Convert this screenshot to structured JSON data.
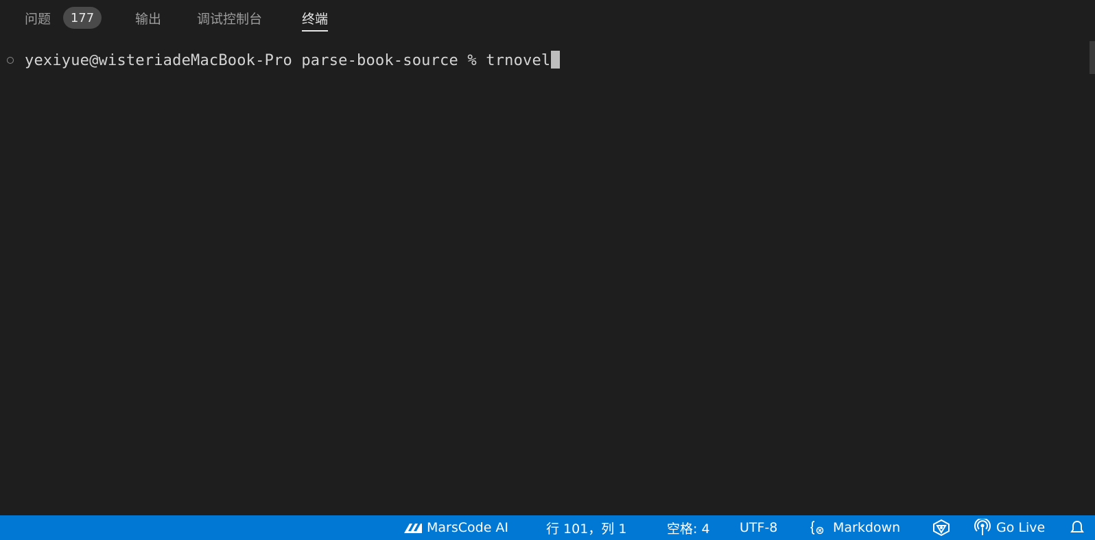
{
  "tabs": [
    {
      "label": "问题",
      "badge": "177"
    },
    {
      "label": "输出"
    },
    {
      "label": "调试控制台"
    },
    {
      "label": "终端"
    }
  ],
  "terminal": {
    "prompt": "yexiyue@wisteriadeMacBook-Pro parse-book-source % ",
    "command": "trnovel"
  },
  "statusbar": {
    "marscode": "MarsCode AI",
    "position": "行 101，列 1",
    "spaces": "空格: 4",
    "encoding": "UTF-8",
    "language": "Markdown",
    "golive": "Go Live"
  },
  "colors": {
    "statusbar_bg": "#0078d4",
    "panel_bg": "#1e1e1e",
    "text_active": "#e7e7e7",
    "text_inactive": "#9d9d9d"
  },
  "icons": {
    "marscode": "marscode-logo-icon",
    "language": "braces-icon",
    "copilot": "copilot-icon",
    "golive": "broadcast-icon"
  }
}
